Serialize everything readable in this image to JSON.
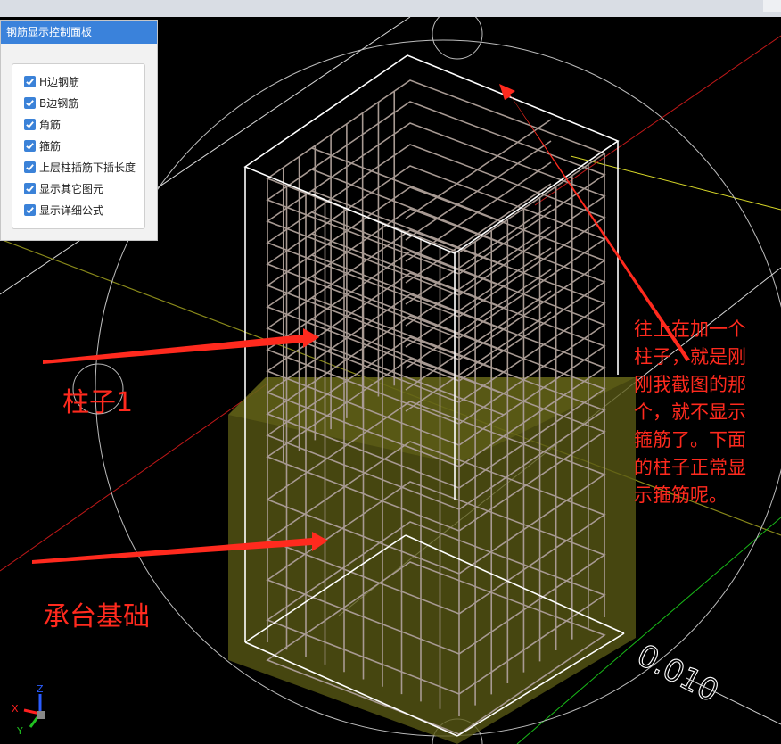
{
  "panel": {
    "title": "钢筋显示控制面板",
    "options": [
      {
        "label": "H边钢筋",
        "checked": true
      },
      {
        "label": "B边钢筋",
        "checked": true
      },
      {
        "label": "角筋",
        "checked": true
      },
      {
        "label": "箍筋",
        "checked": true
      },
      {
        "label": "上层柱插筋下插长度",
        "checked": true
      },
      {
        "label": "显示其它图元",
        "checked": true
      },
      {
        "label": "显示详细公式",
        "checked": true
      }
    ]
  },
  "annotations": {
    "column_label": "柱子1",
    "foundation_label": "承台基础",
    "note_lines": [
      "往上在加一个",
      "柱子，就是刚",
      "刚我截图的那",
      "个，就不显示",
      "箍筋了。下面",
      "的柱子正常显",
      "示箍筋呢。"
    ]
  },
  "scene": {
    "dimension_text": "0.010",
    "axis_labels": {
      "x": "X",
      "y": "Y",
      "z": "Z"
    }
  },
  "colors": {
    "annotation": "#ff2a1e",
    "rebar": "#a89a93",
    "foundation_fill": "#5a5a14",
    "panel_header": "#3a82db"
  }
}
